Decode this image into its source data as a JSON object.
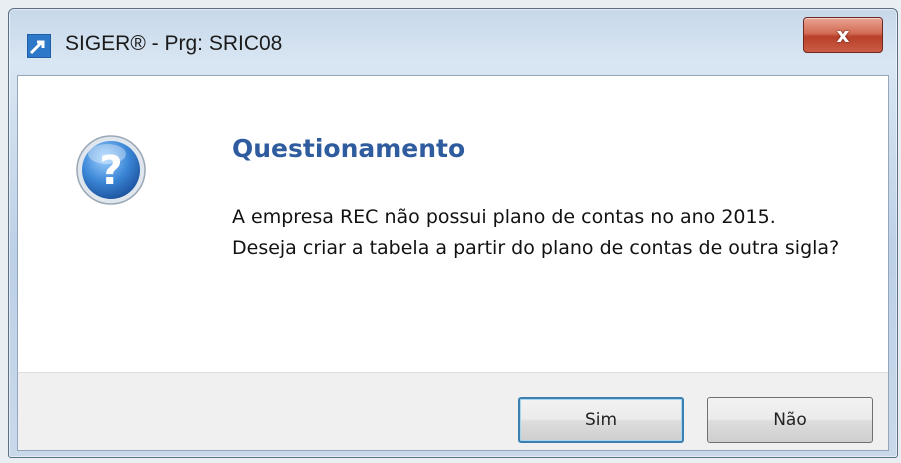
{
  "window": {
    "title": "SIGER® - Prg: SRIC08",
    "close_label": "x"
  },
  "dialog": {
    "icon": "question-icon",
    "heading": "Questionamento",
    "message_line1": "A empresa REC não possui plano de contas no ano 2015.",
    "message_line2": "Deseja criar a tabela a partir do plano de contas de outra sigla?"
  },
  "buttons": {
    "yes_label": "Sim",
    "no_label": "Não"
  },
  "colors": {
    "heading": "#2f5c9e",
    "close_button": "#c4503a",
    "default_button_border": "#3c7fb1"
  }
}
